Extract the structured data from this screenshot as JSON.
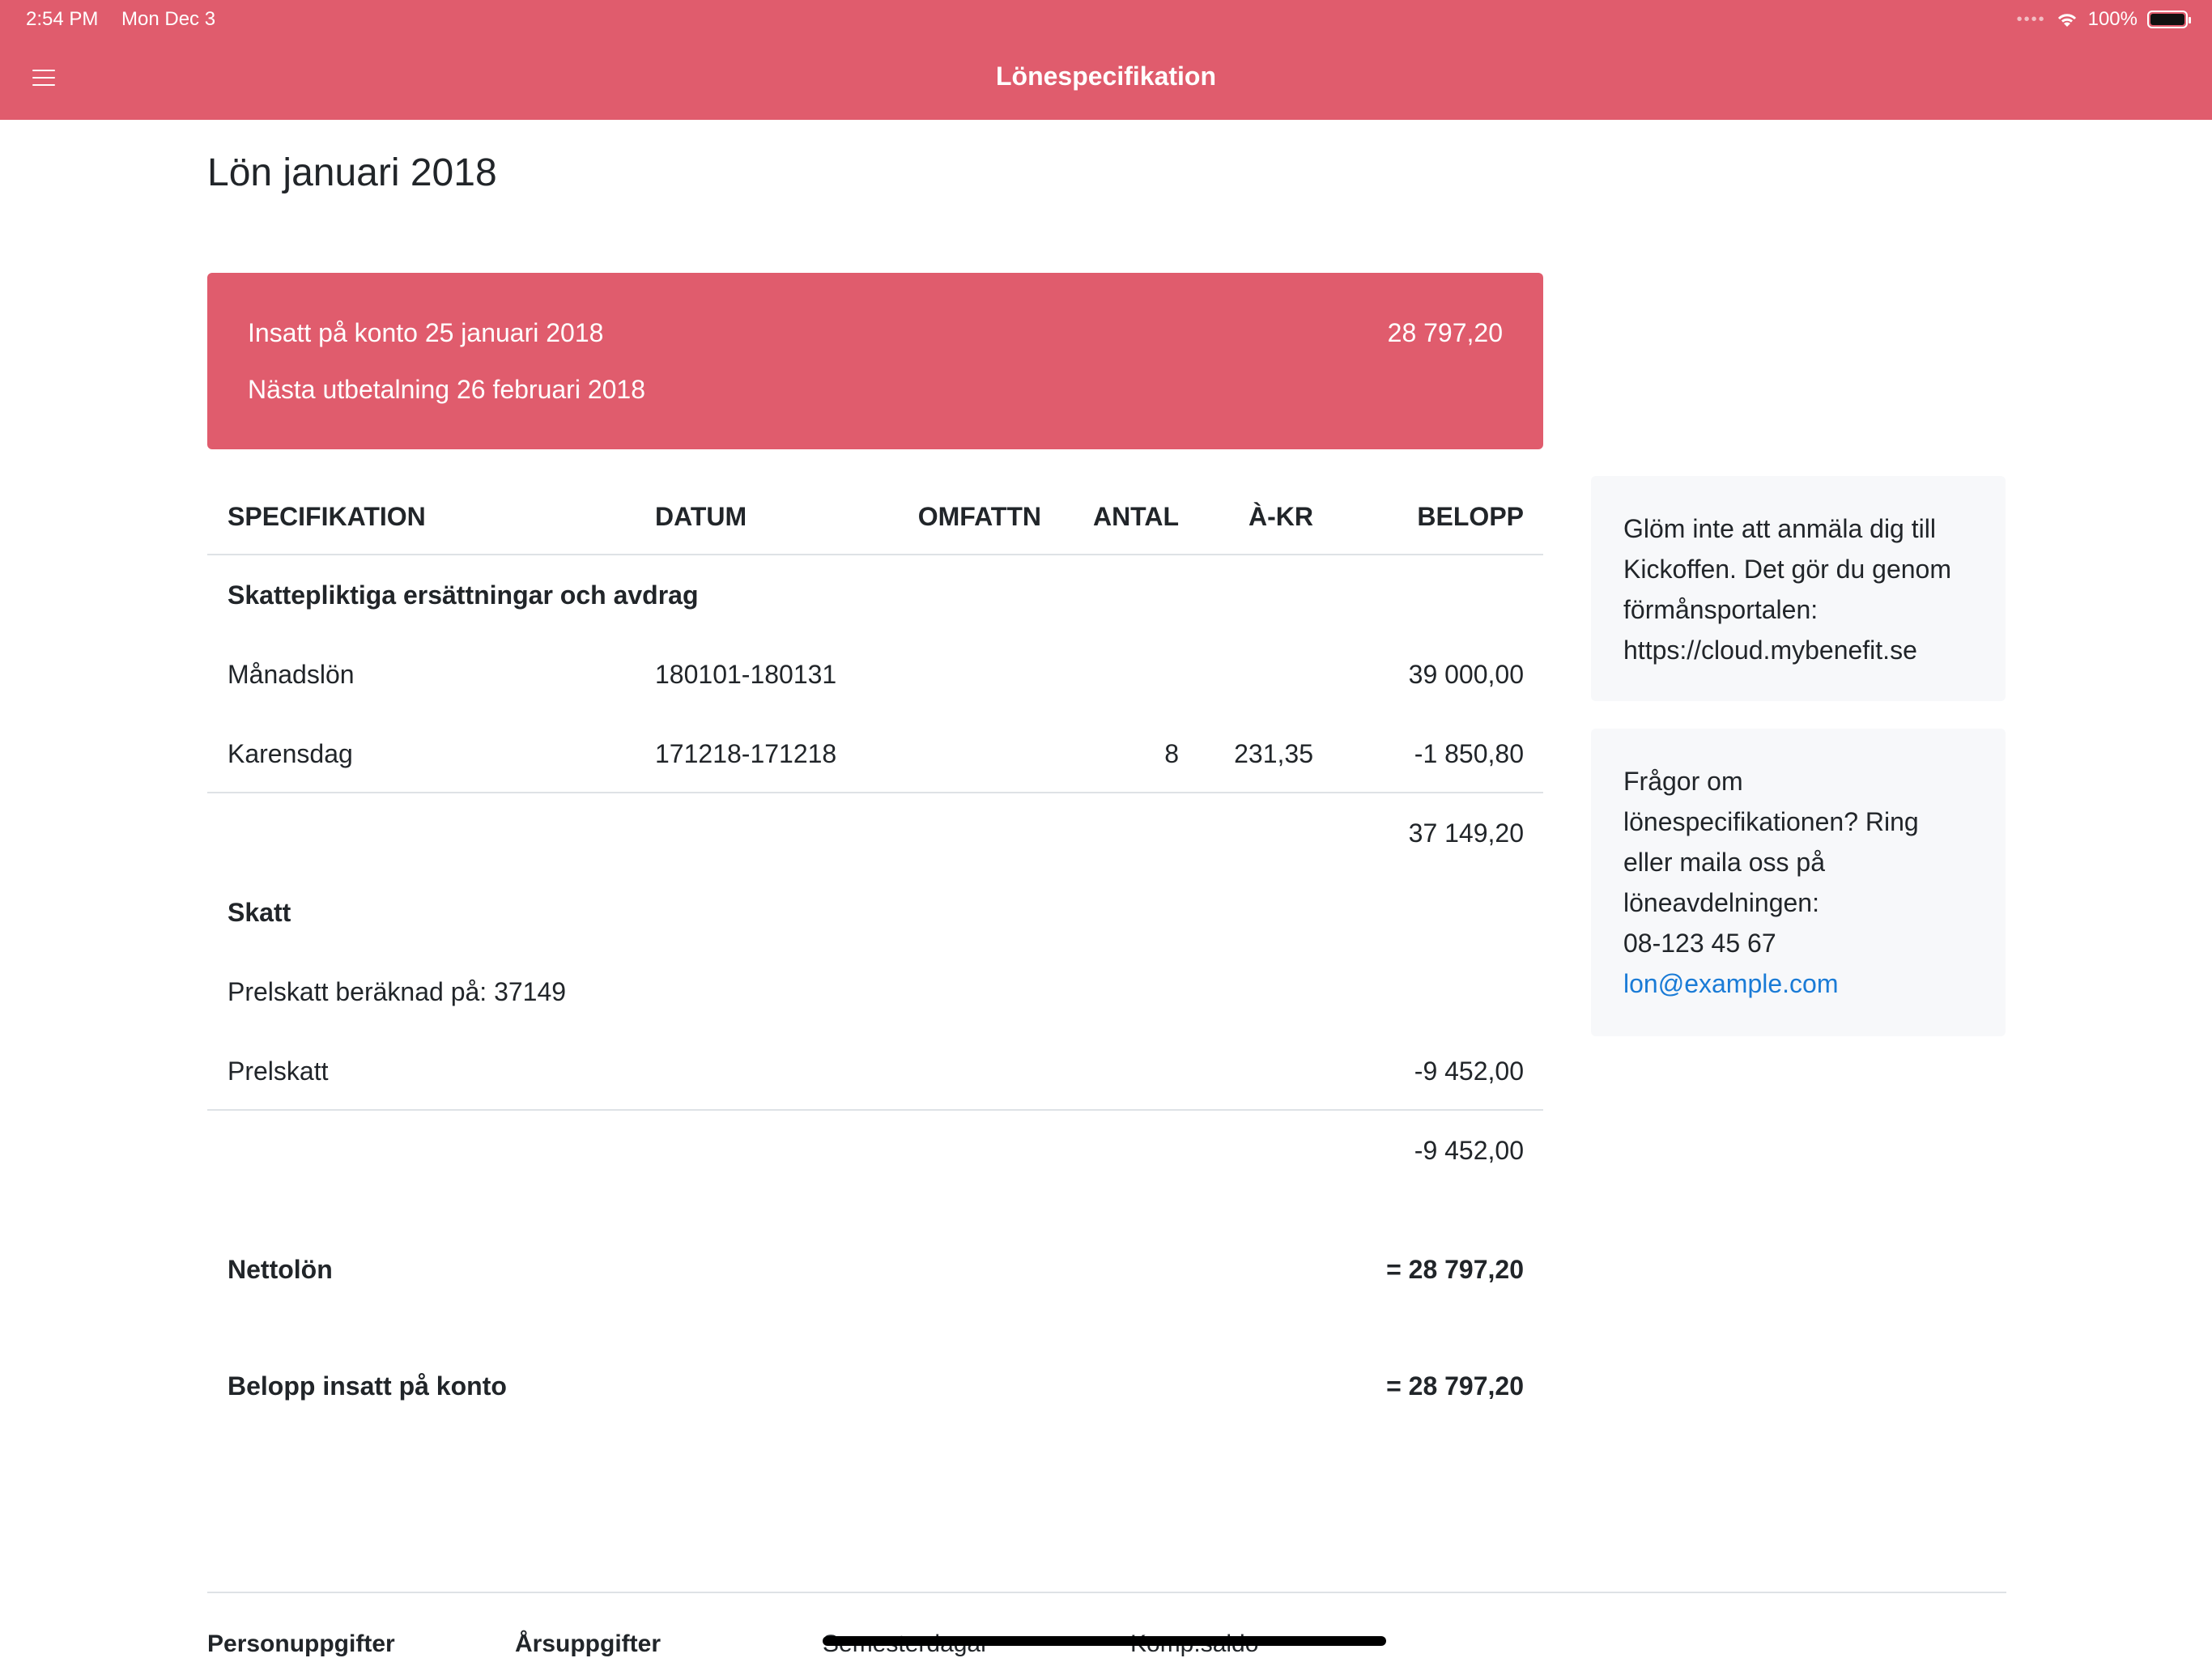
{
  "status_bar": {
    "time": "2:54 PM",
    "date": "Mon Dec 3",
    "battery": "100%"
  },
  "header": {
    "title": "Lönespecifikation"
  },
  "page": {
    "title": "Lön januari 2018"
  },
  "payment": {
    "deposited_label": "Insatt på konto 25 januari 2018",
    "deposited_amount": "28 797,20",
    "next_payment": "Nästa utbetalning 26 februari 2018"
  },
  "table": {
    "headers": {
      "spec": "SPECIFIKATION",
      "datum": "DATUM",
      "omfattn": "OMFATTN",
      "antal": "ANTAL",
      "akr": "À-KR",
      "belopp": "BELOPP"
    },
    "section1": {
      "title": "Skattepliktiga ersättningar och avdrag",
      "rows": [
        {
          "spec": "Månadslön",
          "datum": "180101-180131",
          "omfattn": "",
          "antal": "",
          "akr": "",
          "belopp": "39 000,00"
        },
        {
          "spec": "Karensdag",
          "datum": "171218-171218",
          "omfattn": "",
          "antal": "8",
          "akr": "231,35",
          "belopp": "-1 850,80"
        }
      ],
      "subtotal": "37 149,20"
    },
    "section2": {
      "title": "Skatt",
      "rows": [
        {
          "spec": "Prelskatt beräknad på: 37149",
          "belopp": ""
        },
        {
          "spec": "Prelskatt",
          "belopp": "-9 452,00"
        }
      ],
      "subtotal": "-9 452,00"
    },
    "netto": {
      "label": "Nettolön",
      "value": "= 28 797,20"
    },
    "insatt": {
      "label": "Belopp insatt på konto",
      "value": "= 28 797,20"
    }
  },
  "notes": {
    "kickoff": "Glöm inte att anmäla dig till Kickoffen. Det gör du genom förmånsportalen: https://cloud.mybenefit.se",
    "questions": "Frågor om lönespecifikationen? Ring eller maila oss på löneavdelningen:",
    "phone": "08-123 45 67",
    "email": "lon@example.com"
  },
  "footer": {
    "links": [
      "Personuppgifter",
      "Årsuppgifter",
      "Semesterdagar",
      "Komp.saldo"
    ]
  }
}
